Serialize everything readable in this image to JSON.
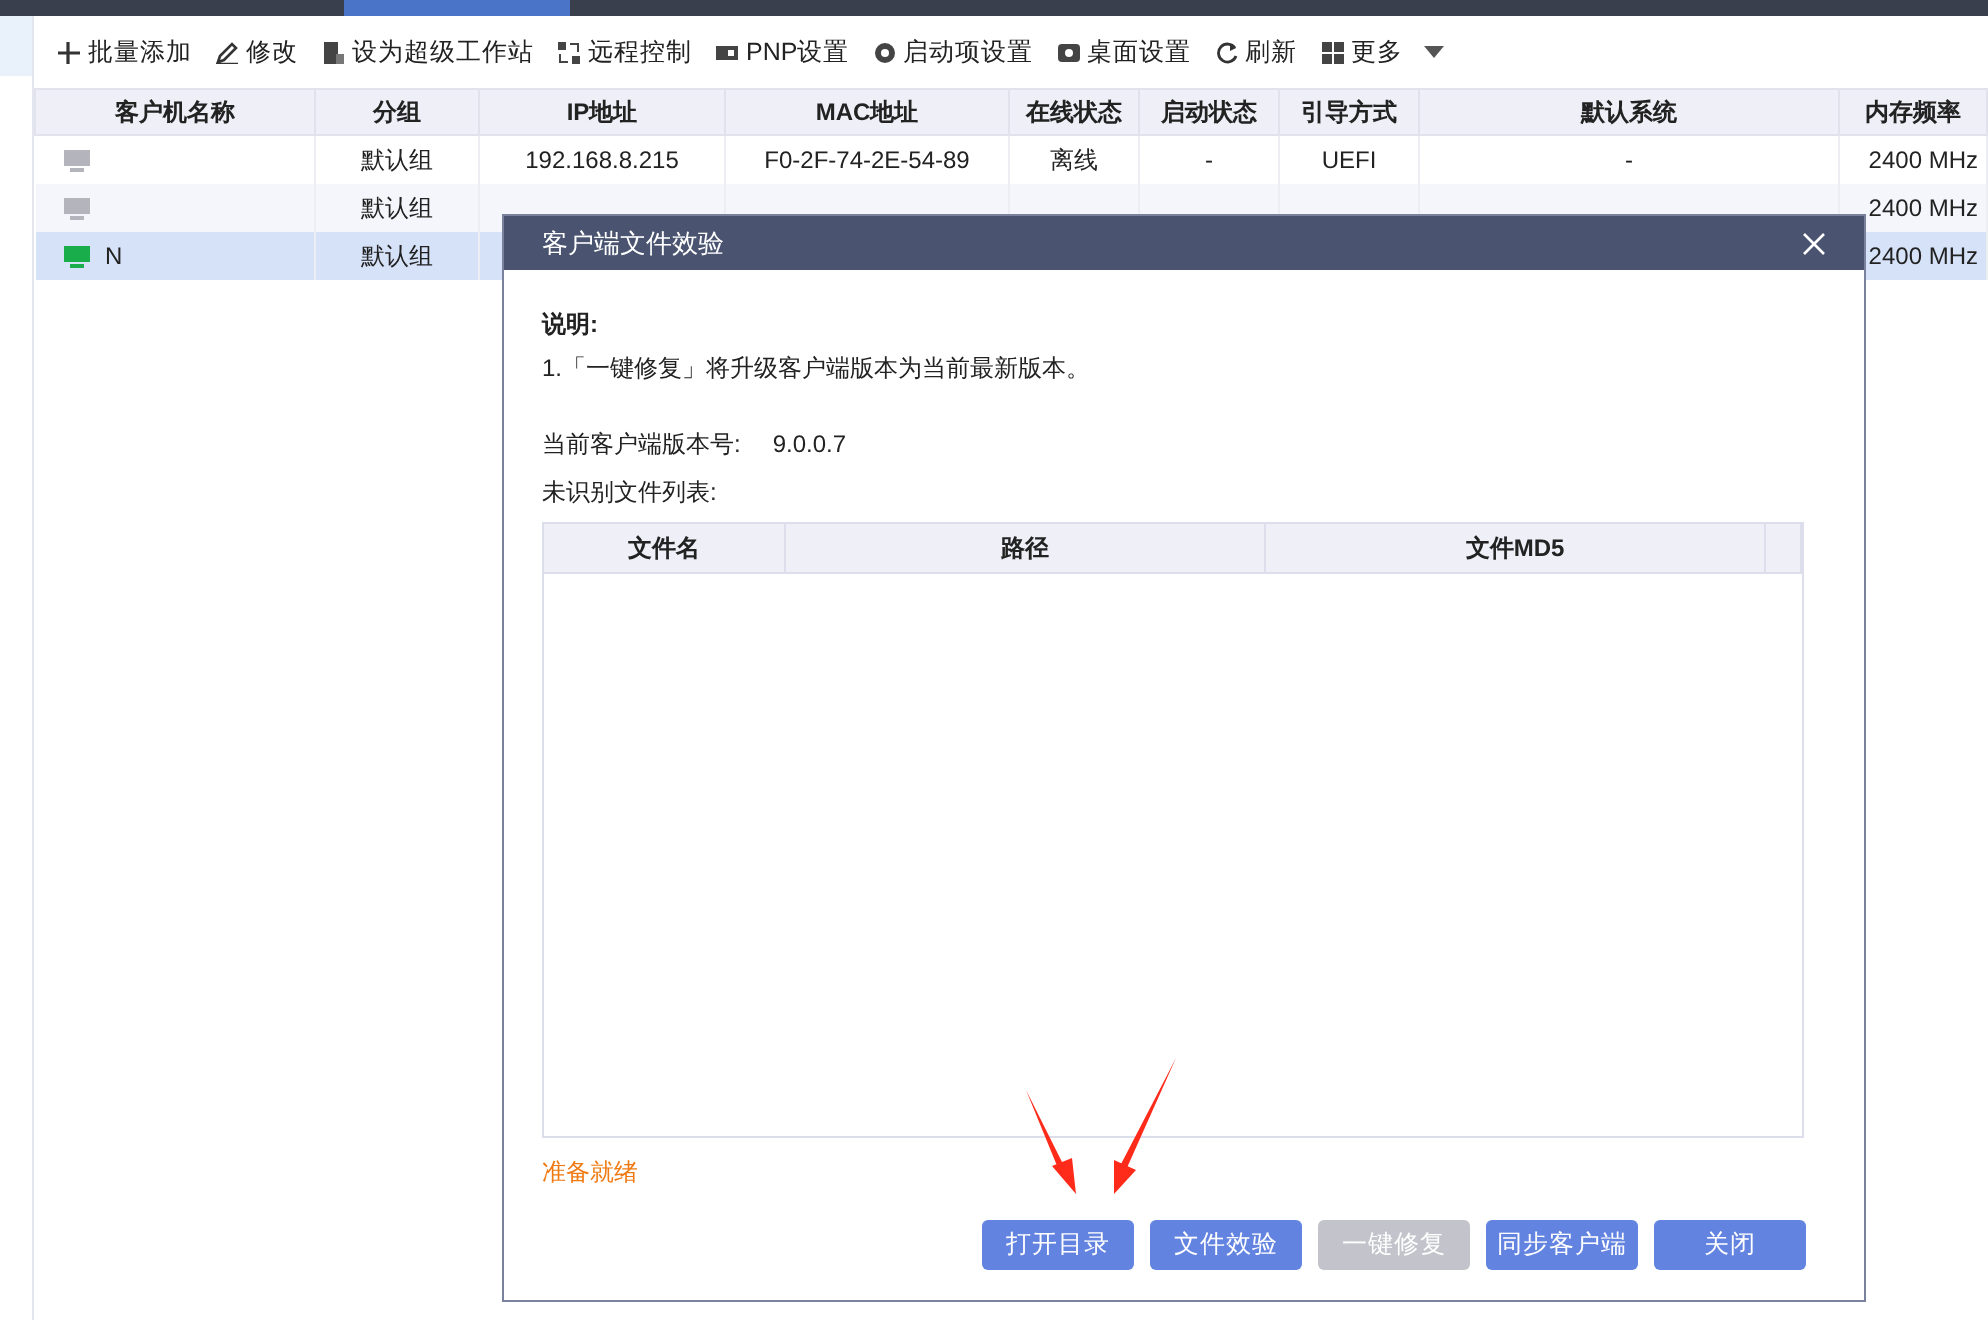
{
  "toolbar": [
    {
      "kind": "action",
      "label": "批量添加"
    },
    {
      "kind": "action",
      "label": "修改"
    },
    {
      "kind": "action",
      "label": "设为超级工作站"
    },
    {
      "kind": "action",
      "label": "远程控制"
    },
    {
      "kind": "action",
      "label": "PNP设置"
    },
    {
      "kind": "action",
      "label": "启动项设置"
    },
    {
      "kind": "action",
      "label": "桌面设置"
    },
    {
      "kind": "action",
      "label": "刷新"
    },
    {
      "kind": "menu",
      "label": "更多"
    }
  ],
  "table": {
    "columns": [
      "客户机名称",
      "分组",
      "IP地址",
      "MAC地址",
      "在线状态",
      "启动状态",
      "引导方式",
      "默认系统",
      "内存频率"
    ],
    "rows": [
      {
        "selected": false,
        "color": "#b4b4bc",
        "cells": [
          "",
          "默认组",
          "192.168.8.215",
          "F0-2F-74-2E-54-89",
          "离线",
          "-",
          "UEFI",
          "-",
          "2400 MHz"
        ]
      },
      {
        "selected": false,
        "color": "#b4b4bc",
        "cells": [
          "",
          "默认组",
          "",
          "",
          "",
          "",
          "",
          "",
          "2400 MHz"
        ]
      },
      {
        "selected": true,
        "color": "#1aad4b",
        "cells": [
          "N",
          "默认组",
          "",
          "",
          "",
          "",
          "",
          "",
          "2400 MHz"
        ]
      }
    ]
  },
  "dialog": {
    "title": "客户端文件效验",
    "note_heading": "说明:",
    "note": "1.「一键修复」将升级客户端版本为当前最新版本。",
    "version_label": "当前客户端版本号:",
    "version": "9.0.0.7",
    "list_label": "未识别文件列表:",
    "columns": [
      "文件名",
      "路径",
      "文件MD5"
    ],
    "status": "准备就绪",
    "buttons": [
      {
        "label": "打开目录",
        "disabled": false
      },
      {
        "label": "文件效验",
        "disabled": false
      },
      {
        "label": "一键修复",
        "disabled": true
      },
      {
        "label": "同步客户端",
        "disabled": false
      },
      {
        "label": "关闭",
        "disabled": false
      }
    ]
  }
}
